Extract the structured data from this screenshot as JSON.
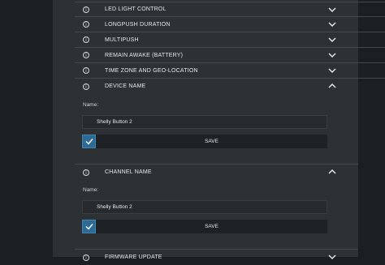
{
  "sections": [
    {
      "label": "LED LIGHT CONTROL",
      "expanded": false
    },
    {
      "label": "LONGPUSH DURATION",
      "expanded": false
    },
    {
      "label": "MULTIPUSH",
      "expanded": false
    },
    {
      "label": "REMAIN AWAKE (BATTERY)",
      "expanded": false
    },
    {
      "label": "TIME ZONE AND GEO-LOCATION",
      "expanded": false
    },
    {
      "label": "DEVICE NAME",
      "expanded": true
    },
    {
      "label": "CHANNEL NAME",
      "expanded": true
    },
    {
      "label": "FIRMWARE UPDATE",
      "expanded": false
    }
  ],
  "device_name": {
    "field_label": "Name:",
    "value": "Shelly Button 2",
    "checked": true,
    "save_label": "SAVE"
  },
  "channel_name": {
    "field_label": "Name:",
    "value": "Shelly Button 2",
    "checked": true,
    "save_label": "SAVE"
  },
  "icons": {
    "info": "info-circle-icon",
    "chevron_down": "chevron-down-icon",
    "chevron_up": "chevron-up-icon",
    "check": "checkmark-icon"
  },
  "colors": {
    "accent": "#2d6a94",
    "panel": "#2e3133",
    "background": "#1c1f21"
  }
}
